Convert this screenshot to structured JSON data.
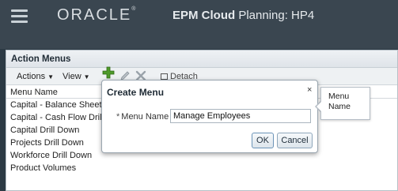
{
  "header": {
    "logo": "ORACLE",
    "logo_mark": "®",
    "title_bold": "EPM Cloud",
    "title_rest": " Planning: HP4"
  },
  "panel": {
    "title": "Action Menus",
    "toolbar": {
      "actions_label": "Actions",
      "view_label": "View",
      "detach_label": "Detach"
    },
    "column_header": "Menu Name",
    "rows": [
      "Capital - Balance Sheet",
      "Capital - Cash Flow Drill",
      "Capital Drill Down",
      "Projects Drill Down",
      "Workforce Drill Down",
      "Product Volumes"
    ]
  },
  "dialog": {
    "title": "Create Menu",
    "close": "×",
    "required_mark": "*",
    "field_label": "Menu Name",
    "field_value": "Manage Employees",
    "ok_label": "OK",
    "cancel_label": "Cancel"
  },
  "tooltip": {
    "line1": "Menu",
    "line2": "Name"
  },
  "colors": {
    "header_bg": "#3a4650",
    "add_icon": "#4f9a2a",
    "disabled_icon": "#9aa3aa"
  },
  "icons": [
    "menu-icon",
    "add-icon",
    "edit-icon",
    "delete-icon",
    "detach-icon",
    "close-icon"
  ]
}
